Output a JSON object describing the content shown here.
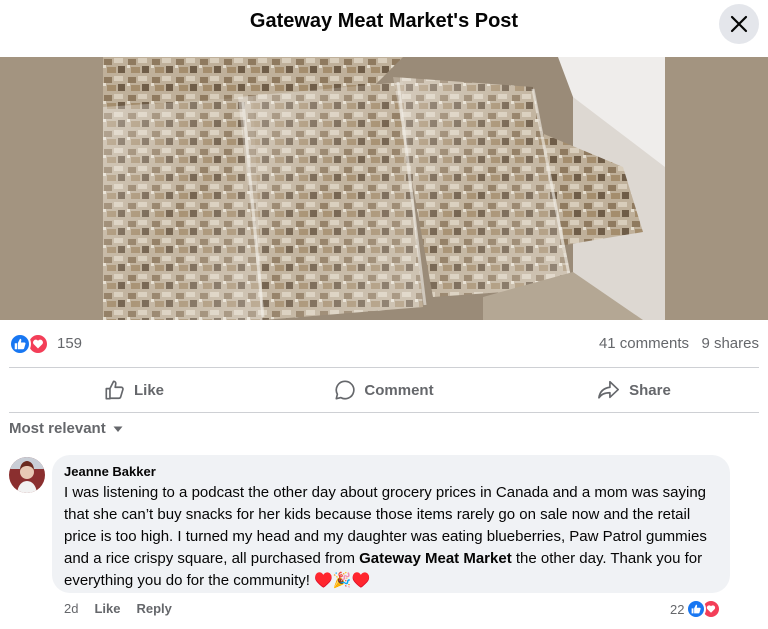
{
  "header": {
    "title": "Gateway Meat Market's Post"
  },
  "post": {
    "reactions": {
      "count": "159",
      "icons": [
        "like-icon",
        "love-icon"
      ]
    },
    "comments_count": "41 comments",
    "shares_count": "9 shares",
    "actions": {
      "like": "Like",
      "comment": "Comment",
      "share": "Share"
    }
  },
  "sort": {
    "label": "Most relevant"
  },
  "comment": {
    "author": "Jeanne Bakker",
    "text_before": "I was listening to a podcast the other day about grocery prices in Canada and a mom was saying that she can’t buy snacks for her kids because those items rarely go on sale now and the retail price is too high. I turned my head and my daughter was eating blueberries, Paw Patrol gummies and a rice crispy square, all purchased from ",
    "mention": "Gateway Meat Market",
    "text_after": " the other day. Thank you for everything you do for the community! ",
    "emoji": "♥️🎉♥️",
    "time": "2d",
    "like_label": "Like",
    "reply_label": "Reply",
    "reaction_count": "22"
  },
  "colors": {
    "accent": "#1877f2",
    "love": "#f33e58",
    "secondary_text": "#65676b",
    "bubble": "#f0f2f5"
  }
}
